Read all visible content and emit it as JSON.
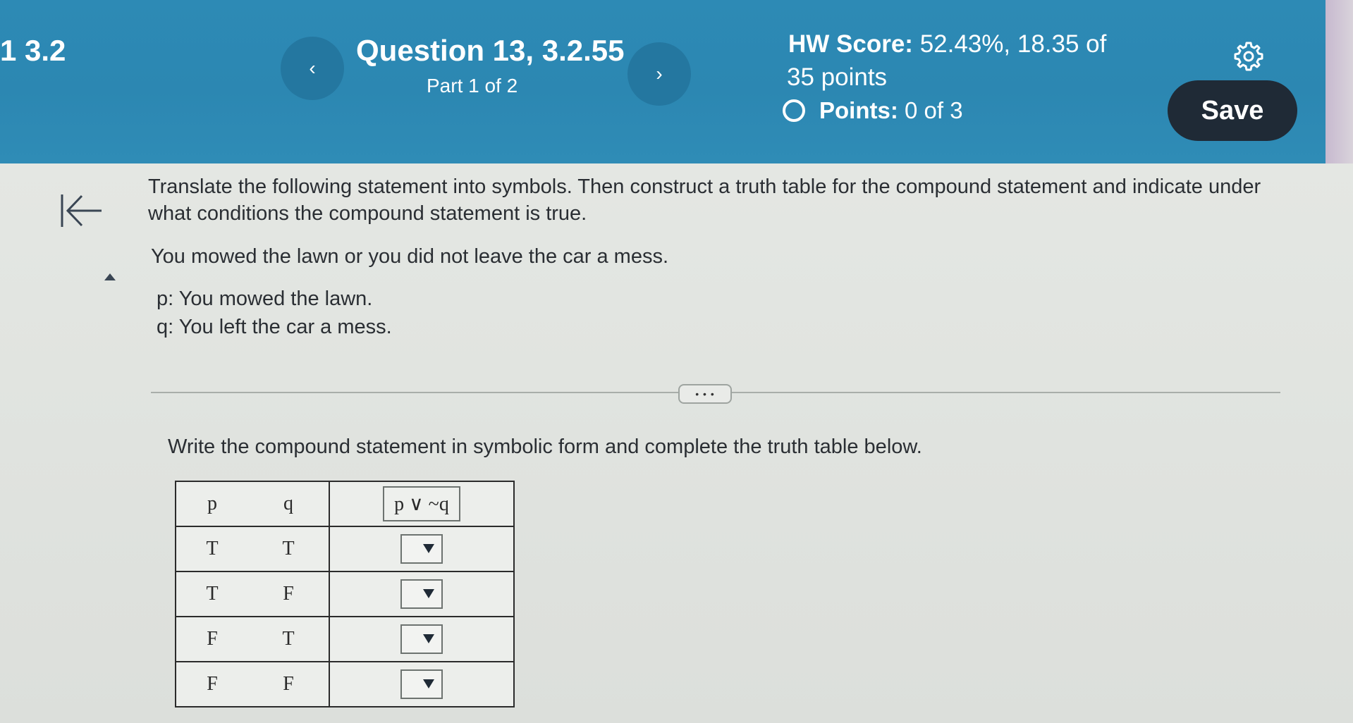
{
  "header": {
    "section": "1 3.2",
    "question_title": "Question 13, 3.2.55",
    "part": "Part 1 of 2",
    "hw_score_label": "HW Score:",
    "hw_score_value": "52.43%, 18.35 of",
    "hw_score_total": "35 points",
    "points_label": "Points:",
    "points_value": "0 of 3",
    "save_label": "Save",
    "prev_icon": "‹",
    "next_icon": "›"
  },
  "question": {
    "instructions": "Translate the following statement into symbols. Then construct a truth table for the compound statement and indicate under what conditions the compound statement is true.",
    "statement": "You mowed the lawn or you did not leave the car a mess.",
    "p_def": "p: You mowed the lawn.",
    "q_def": "q: You left the car a mess.",
    "more_label": "• • •",
    "prompt": "Write the compound statement in symbolic form and complete the truth table below."
  },
  "truth_table": {
    "headers": {
      "p": "p",
      "q": "q",
      "expression": "p ∨ ~q"
    },
    "rows": [
      {
        "p": "T",
        "q": "T",
        "answer": ""
      },
      {
        "p": "T",
        "q": "F",
        "answer": ""
      },
      {
        "p": "F",
        "q": "T",
        "answer": ""
      },
      {
        "p": "F",
        "q": "F",
        "answer": ""
      }
    ]
  },
  "colors": {
    "header_bg": "#2d8ab5",
    "save_bg": "#1f2a36",
    "page_bg": "#e4e7e3"
  }
}
